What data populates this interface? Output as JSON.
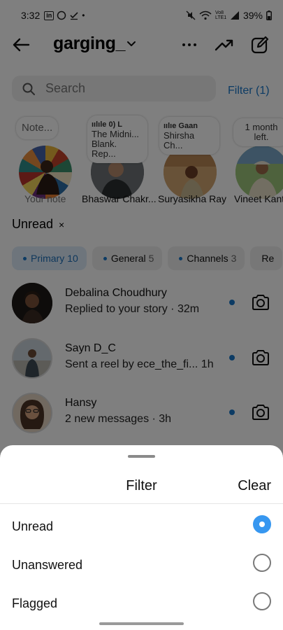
{
  "status_bar": {
    "time": "3:32",
    "battery": "39%",
    "network": "Vo8 LTE1"
  },
  "header": {
    "username": "garging_"
  },
  "search": {
    "placeholder": "Search"
  },
  "filter_link": "Filter (1)",
  "notes": [
    {
      "bubble": "Note...",
      "label": "Your note"
    },
    {
      "bubble_line1": "ıılıle 0)   L",
      "bubble_line2": "The Midni...",
      "bubble_line3": "Blank. Rep...",
      "label": "Bhaswar Chakr..."
    },
    {
      "bubble_line1": "ıılıe    Gaan",
      "bubble_line2": "Shirsha Ch...",
      "label": "Suryasikha Ray"
    },
    {
      "bubble_line1": "1 month",
      "bubble_line2": "left.",
      "label": "Vineet Kant"
    }
  ],
  "active_filter": "Unread",
  "tabs": [
    {
      "label": "Primary",
      "count": "10"
    },
    {
      "label": "General",
      "count": "5"
    },
    {
      "label": "Channels",
      "count": "3"
    },
    {
      "label": "Re",
      "count": ""
    }
  ],
  "messages": [
    {
      "name": "Debalina Choudhury",
      "subtitle": "Replied to your story · 32m"
    },
    {
      "name": "Sayn D_C",
      "subtitle": "Sent a reel by ece_the_fi...  1h"
    },
    {
      "name": "Hansy",
      "subtitle": "2 new messages · 3h"
    }
  ],
  "sheet": {
    "title": "Filter",
    "clear": "Clear",
    "options": [
      {
        "label": "Unread",
        "selected": true
      },
      {
        "label": "Unanswered",
        "selected": false
      },
      {
        "label": "Flagged",
        "selected": false
      }
    ]
  },
  "colors": {
    "accent": "#3797f0",
    "link": "#1877c9",
    "tab_active_bg": "#dcebf8"
  }
}
